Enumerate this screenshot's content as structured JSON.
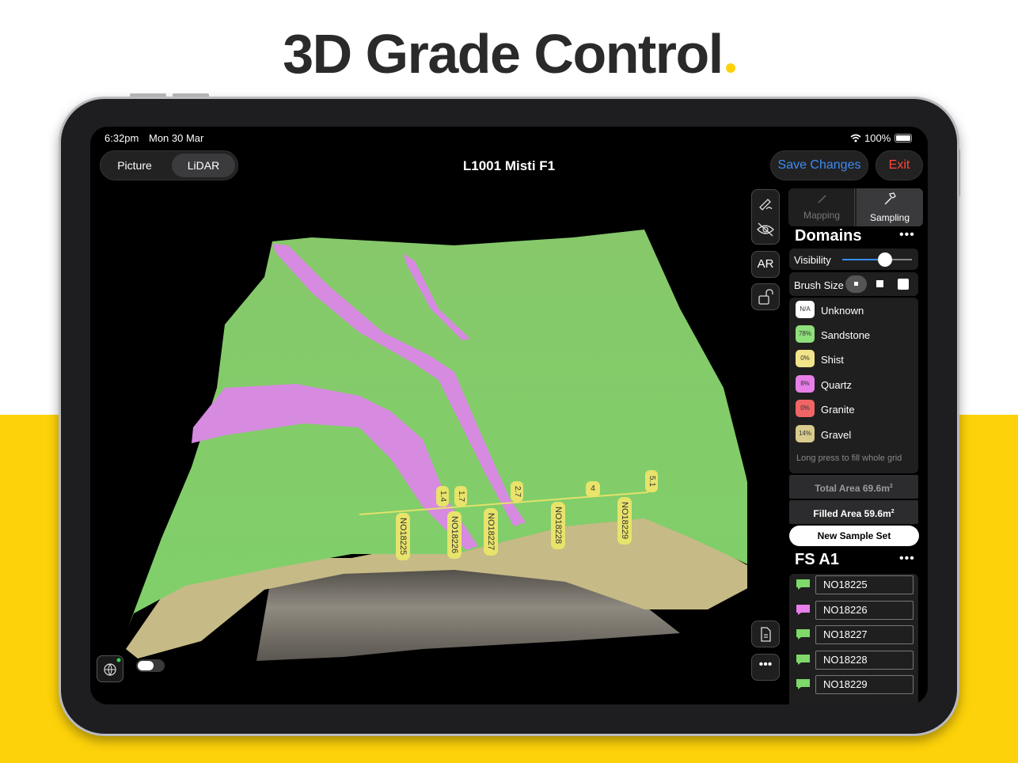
{
  "headline": "3D Grade Control",
  "status_bar": {
    "time": "6:32pm",
    "date": "Mon 30 Mar",
    "battery": "100%"
  },
  "view_mode": {
    "options": [
      "Picture",
      "LiDAR"
    ],
    "selected": "LiDAR"
  },
  "title": "L1001 Misti F1",
  "actions": {
    "save_label": "Save Changes",
    "exit_label": "Exit"
  },
  "tools": {
    "ar_label": "AR"
  },
  "mode_tabs": {
    "mapping_label": "Mapping",
    "sampling_label": "Sampling",
    "active": "Sampling"
  },
  "domains_panel": {
    "title": "Domains",
    "visibility_label": "Visibility",
    "visibility_level": 0.6,
    "brush_size_label": "Brush Size",
    "brush_sizes": [
      "small",
      "medium",
      "large"
    ],
    "selected_brush": "small",
    "items": [
      {
        "badge": "N/A",
        "name": "Unknown",
        "color": "#ffffff"
      },
      {
        "badge": "78%",
        "name": "Sandstone",
        "color": "#8ee07a"
      },
      {
        "badge": "0%",
        "name": "Shist",
        "color": "#f2e48a"
      },
      {
        "badge": "8%",
        "name": "Quartz",
        "color": "#e87fe8"
      },
      {
        "badge": "0%",
        "name": "Granite",
        "color": "#f06565"
      },
      {
        "badge": "14%",
        "name": "Gravel",
        "color": "#d8cb8d"
      }
    ],
    "hint": "Long press to fill whole grid",
    "total_area_label": "Total Area 69.6m",
    "filled_area_label": "Filled Area 59.6m",
    "area_superscript": "2"
  },
  "new_sample_set_label": "New Sample Set",
  "sample_set": {
    "title": "FS A1",
    "samples": [
      {
        "id": "NO18225",
        "color": "#7ed86a"
      },
      {
        "id": "NO18226",
        "color": "#e87fe8"
      },
      {
        "id": "NO18227",
        "color": "#7ed86a"
      },
      {
        "id": "NO18228",
        "color": "#7ed86a"
      },
      {
        "id": "NO18229",
        "color": "#7ed86a"
      }
    ]
  },
  "scene": {
    "line_values": [
      "1.4",
      "1.7",
      "2.7",
      "4",
      "5.1"
    ],
    "sample_tags": [
      "NO18225",
      "NO18226",
      "NO18227",
      "NO18228",
      "NO18229"
    ]
  },
  "colors": {
    "accent_blue": "#3b8cf5",
    "exit_red": "#ff453a",
    "brand_yellow": "#fdd20a"
  }
}
